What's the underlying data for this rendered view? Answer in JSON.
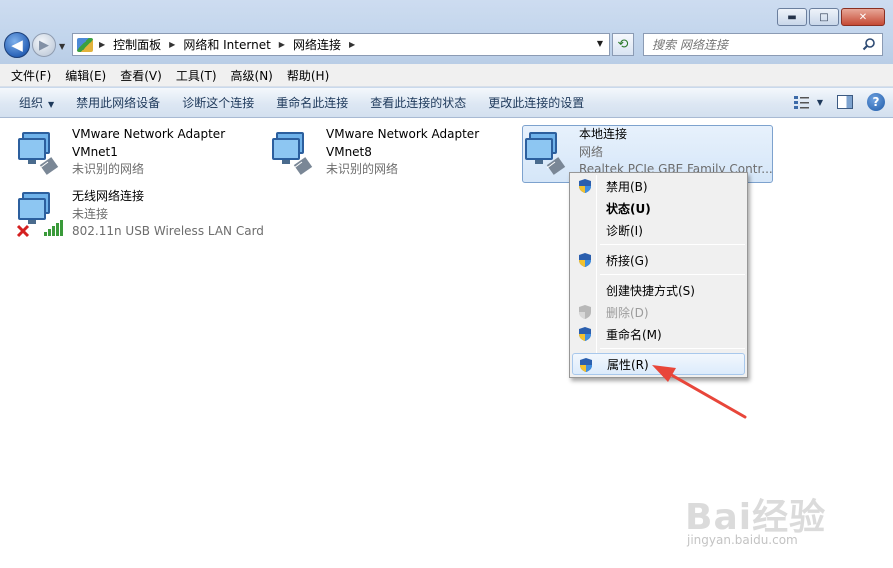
{
  "window": {
    "minimize_glyph": "▬",
    "maximize_glyph": "□",
    "close_glyph": "✕"
  },
  "address_bar": {
    "crumbs": [
      "控制面板",
      "网络和 Internet",
      "网络连接"
    ]
  },
  "search": {
    "placeholder": "搜索 网络连接"
  },
  "menu": {
    "items": [
      "文件(F)",
      "编辑(E)",
      "查看(V)",
      "工具(T)",
      "高级(N)",
      "帮助(H)"
    ]
  },
  "commands": {
    "organize": "组织",
    "disable_device": "禁用此网络设备",
    "diagnose": "诊断这个连接",
    "rename": "重命名此连接",
    "view_status": "查看此连接的状态",
    "change_settings": "更改此连接的设置"
  },
  "connections": [
    {
      "name": "VMware Network Adapter",
      "name2": "VMnet1",
      "status": "未识别的网络"
    },
    {
      "name": "VMware Network Adapter",
      "name2": "VMnet8",
      "status": "未识别的网络"
    },
    {
      "name": "本地连接",
      "status": "网络",
      "device": "Realtek PCIe GBE Family Contr..."
    },
    {
      "name": "无线网络连接",
      "status": "未连接",
      "device": "802.11n USB Wireless LAN Card"
    }
  ],
  "context_menu": {
    "disable": "禁用(B)",
    "status": "状态(U)",
    "diagnose": "诊断(I)",
    "bridge": "桥接(G)",
    "create_shortcut": "创建快捷方式(S)",
    "delete": "删除(D)",
    "rename": "重命名(M)",
    "properties": "属性(R)"
  },
  "watermark": {
    "brand": "Bai经验",
    "url": "jingyan.baidu.com"
  },
  "colors": {
    "annotation_arrow": "#e8463a",
    "selection": "#d5e6f8"
  }
}
